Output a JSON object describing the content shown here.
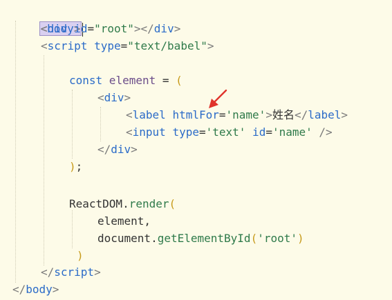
{
  "code": {
    "body_open": {
      "lt": "<",
      "tag": "body",
      "gt": ">"
    },
    "div_root": {
      "lt": "<",
      "tag": "div",
      "attr": " id",
      "eq": "=",
      "val": "\"root\"",
      "gt": ">",
      "close": "</",
      "ctag": "div",
      "cgt": ">"
    },
    "script_open": {
      "lt": "<",
      "tag": "script",
      "attr": " type",
      "eq": "=",
      "val": "\"text/babel\"",
      "gt": ">"
    },
    "const_line": {
      "kw": "const",
      "name": " element",
      "eq": " = ",
      "paren": "("
    },
    "div_open": {
      "lt": "<",
      "tag": "div",
      "gt": ">"
    },
    "label_line": {
      "lt": "<",
      "tag": "label",
      "attr": " htmlFor",
      "eq": "=",
      "val": "'name'",
      "gt": ">",
      "text": "姓名",
      "close": "</",
      "ctag": "label",
      "cgt": ">"
    },
    "input_line": {
      "lt": "<",
      "tag": "input",
      "attr1": " type",
      "eq1": "=",
      "val1": "'text'",
      "attr2": " id",
      "eq2": "=",
      "val2": "'name'",
      "end": " />"
    },
    "div_close": {
      "lt": "</",
      "tag": "div",
      "gt": ">"
    },
    "close_paren": {
      "paren": ")",
      "semi": ";"
    },
    "render_line": {
      "obj": "ReactDOM",
      "dot": ".",
      "fn": "render",
      "paren": "("
    },
    "element_arg": {
      "text": "element,"
    },
    "doc_arg": {
      "obj": "document",
      "dot": ".",
      "fn": "getElementById",
      "paren_open": "(",
      "val": "'root'",
      "paren_close": ")"
    },
    "render_close": {
      "paren": ")"
    },
    "script_close": {
      "lt": "</",
      "tag": "script",
      "gt": ">"
    },
    "body_close": {
      "lt": "</",
      "tag": "body",
      "gt": ">"
    }
  },
  "colors": {
    "background": "#fdfbe8",
    "tag": "#2b6bc8",
    "string": "#2f7a4a",
    "paren": "#c79a1a",
    "arrow": "#e0332b"
  },
  "annotation_icon": "red-arrow-icon"
}
